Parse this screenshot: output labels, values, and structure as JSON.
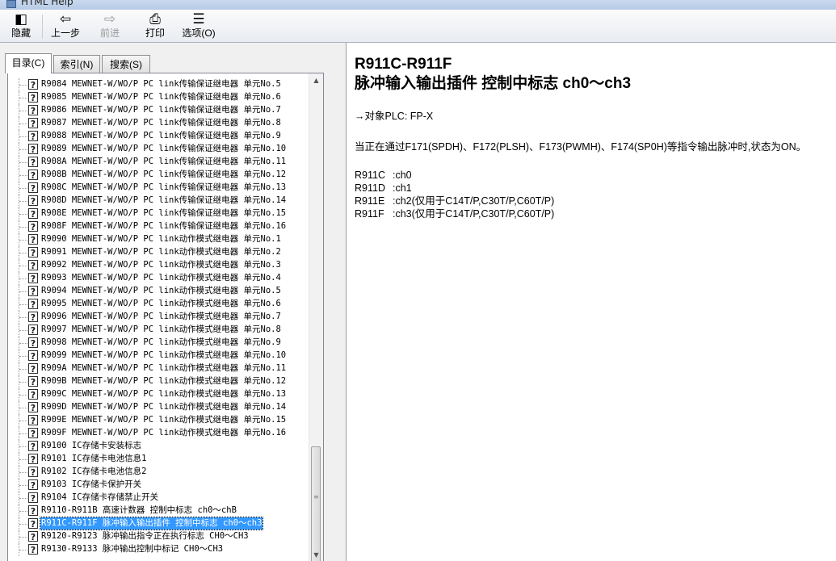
{
  "window": {
    "title": "HTML Help"
  },
  "toolbar": {
    "hide_label": "隐藏",
    "back_label": "上一步",
    "forward_label": "前进",
    "print_label": "打印",
    "options_label": "选项(O)"
  },
  "tabs": [
    {
      "label": "目录(C)"
    },
    {
      "label": "索引(N)"
    },
    {
      "label": "搜索(S)"
    }
  ],
  "tree": {
    "items": [
      "R9084 MEWNET-W/WO/P PC link传输保证继电器 单元No.5",
      "R9085 MEWNET-W/WO/P PC link传输保证继电器 单元No.6",
      "R9086 MEWNET-W/WO/P PC link传输保证继电器 单元No.7",
      "R9087 MEWNET-W/WO/P PC link传输保证继电器 单元No.8",
      "R9088 MEWNET-W/WO/P PC link传输保证继电器 单元No.9",
      "R9089 MEWNET-W/WO/P PC link传输保证继电器 单元No.10",
      "R908A MEWNET-W/WO/P PC link传输保证继电器 单元No.11",
      "R908B MEWNET-W/WO/P PC link传输保证继电器 单元No.12",
      "R908C MEWNET-W/WO/P PC link传输保证继电器 单元No.13",
      "R908D MEWNET-W/WO/P PC link传输保证继电器 单元No.14",
      "R908E MEWNET-W/WO/P PC link传输保证继电器 单元No.15",
      "R908F MEWNET-W/WO/P PC link传输保证继电器 单元No.16",
      "R9090 MEWNET-W/WO/P PC link动作模式继电器 单元No.1",
      "R9091 MEWNET-W/WO/P PC link动作模式继电器 单元No.2",
      "R9092 MEWNET-W/WO/P PC link动作模式继电器 单元No.3",
      "R9093 MEWNET-W/WO/P PC link动作模式继电器 单元No.4",
      "R9094 MEWNET-W/WO/P PC link动作模式继电器 单元No.5",
      "R9095 MEWNET-W/WO/P PC link动作模式继电器 单元No.6",
      "R9096 MEWNET-W/WO/P PC link动作模式继电器 单元No.7",
      "R9097 MEWNET-W/WO/P PC link动作模式继电器 单元No.8",
      "R9098 MEWNET-W/WO/P PC link动作模式继电器 单元No.9",
      "R9099 MEWNET-W/WO/P PC link动作模式继电器 单元No.10",
      "R909A MEWNET-W/WO/P PC link动作模式继电器 单元No.11",
      "R909B MEWNET-W/WO/P PC link动作模式继电器 单元No.12",
      "R909C MEWNET-W/WO/P PC link动作模式继电器 单元No.13",
      "R909D MEWNET-W/WO/P PC link动作模式继电器 单元No.14",
      "R909E MEWNET-W/WO/P PC link动作模式继电器 单元No.15",
      "R909F MEWNET-W/WO/P PC link动作模式继电器 单元No.16",
      "R9100 IC存储卡安装标志",
      "R9101 IC存储卡电池信息1",
      "R9102 IC存储卡电池信息2",
      "R9103 IC存储卡保护开关",
      "R9104 IC存储卡存储禁止开关",
      "R9110-R911B 高速计数器 控制中标志 ch0～chB",
      "R911C-R911F 脉冲输入输出插件  控制中标志  ch0～ch3",
      "R9120-R9123 脉冲输出指令正在执行标志 CH0～CH3",
      "R9130-R9133 脉冲输出控制中标记 CH0～CH3"
    ],
    "selected_index": 34
  },
  "content": {
    "title_line1": "R911C-R911F",
    "title_line2": "脉冲输入输出插件  控制中标志  ch0～ch3",
    "target_plc": "→对象PLC: FP-X",
    "description": "当正在通过F171(SPDH)、F172(PLSH)、F173(PWMH)、F174(SP0H)等指令输出脉冲时,状态为ON。",
    "registers": [
      {
        "name": "R911C",
        "value": ":ch0"
      },
      {
        "name": "R911D",
        "value": ":ch1"
      },
      {
        "name": "R911E",
        "value": ":ch2(仅用于C14T/P,C30T/P,C60T/P)"
      },
      {
        "name": "R911F",
        "value": ":ch3(仅用于C14T/P,C30T/P,C60T/P)"
      }
    ]
  }
}
